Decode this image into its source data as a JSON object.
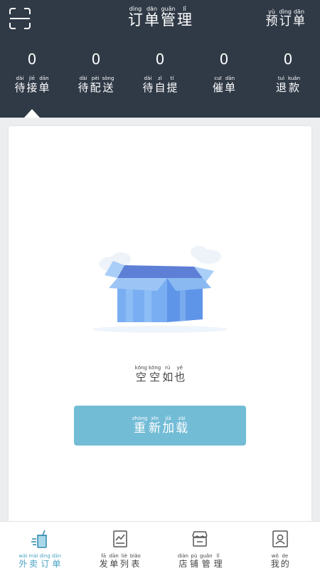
{
  "header": {
    "title": [
      {
        "py": "dìng",
        "hz": "订"
      },
      {
        "py": "dān",
        "hz": "单"
      },
      {
        "py": "guǎn",
        "hz": "管"
      },
      {
        "py": "lǐ",
        "hz": "理"
      }
    ],
    "reserve": [
      {
        "py": "yù",
        "hz": "预"
      },
      {
        "py": "dìng",
        "hz": "订"
      },
      {
        "py": "dān",
        "hz": "单"
      }
    ],
    "stats": [
      {
        "count": "0",
        "label": [
          {
            "py": "dài",
            "hz": "待"
          },
          {
            "py": "jiē",
            "hz": "接"
          },
          {
            "py": "dān",
            "hz": "单"
          }
        ]
      },
      {
        "count": "0",
        "label": [
          {
            "py": "dài",
            "hz": "待"
          },
          {
            "py": "pèi",
            "hz": "配"
          },
          {
            "py": "sòng",
            "hz": "送"
          }
        ]
      },
      {
        "count": "0",
        "label": [
          {
            "py": "dài",
            "hz": "待"
          },
          {
            "py": "zì",
            "hz": "自"
          },
          {
            "py": "tí",
            "hz": "提"
          }
        ]
      },
      {
        "count": "0",
        "label": [
          {
            "py": "cuī",
            "hz": "催"
          },
          {
            "py": "dān",
            "hz": "单"
          }
        ]
      },
      {
        "count": "0",
        "label": [
          {
            "py": "tuì",
            "hz": "退"
          },
          {
            "py": "kuǎn",
            "hz": "款"
          }
        ]
      }
    ]
  },
  "empty": {
    "text": [
      {
        "py": "kōng",
        "hz": "空"
      },
      {
        "py": "kōng",
        "hz": "空"
      },
      {
        "py": "rú",
        "hz": "如"
      },
      {
        "py": "yě",
        "hz": "也"
      }
    ],
    "reload": [
      {
        "py": "zhòng",
        "hz": "重"
      },
      {
        "py": "xīn",
        "hz": "新"
      },
      {
        "py": "jiā",
        "hz": "加"
      },
      {
        "py": "zài",
        "hz": "载"
      }
    ]
  },
  "tabs": [
    {
      "icon": "takeout-cup-icon",
      "active": true,
      "label": [
        {
          "py": "wài",
          "hz": "外"
        },
        {
          "py": "mài",
          "hz": "卖"
        },
        {
          "py": "dìng",
          "hz": "订"
        },
        {
          "py": "dān",
          "hz": "单"
        }
      ]
    },
    {
      "icon": "order-list-icon",
      "active": false,
      "label": [
        {
          "py": "fā",
          "hz": "发"
        },
        {
          "py": "dān",
          "hz": "单"
        },
        {
          "py": "liè",
          "hz": "列"
        },
        {
          "py": "biǎo",
          "hz": "表"
        }
      ]
    },
    {
      "icon": "store-icon",
      "active": false,
      "label": [
        {
          "py": "diàn",
          "hz": "店"
        },
        {
          "py": "pù",
          "hz": "铺"
        },
        {
          "py": "guǎn",
          "hz": "管"
        },
        {
          "py": "lǐ",
          "hz": "理"
        }
      ]
    },
    {
      "icon": "profile-card-icon",
      "active": false,
      "label": [
        {
          "py": "wǒ",
          "hz": "我"
        },
        {
          "py": "de",
          "hz": "的"
        }
      ]
    }
  ],
  "colors": {
    "header_bg": "#303a47",
    "accent": "#4aa3c4",
    "reload_bg": "#73bcd6"
  }
}
